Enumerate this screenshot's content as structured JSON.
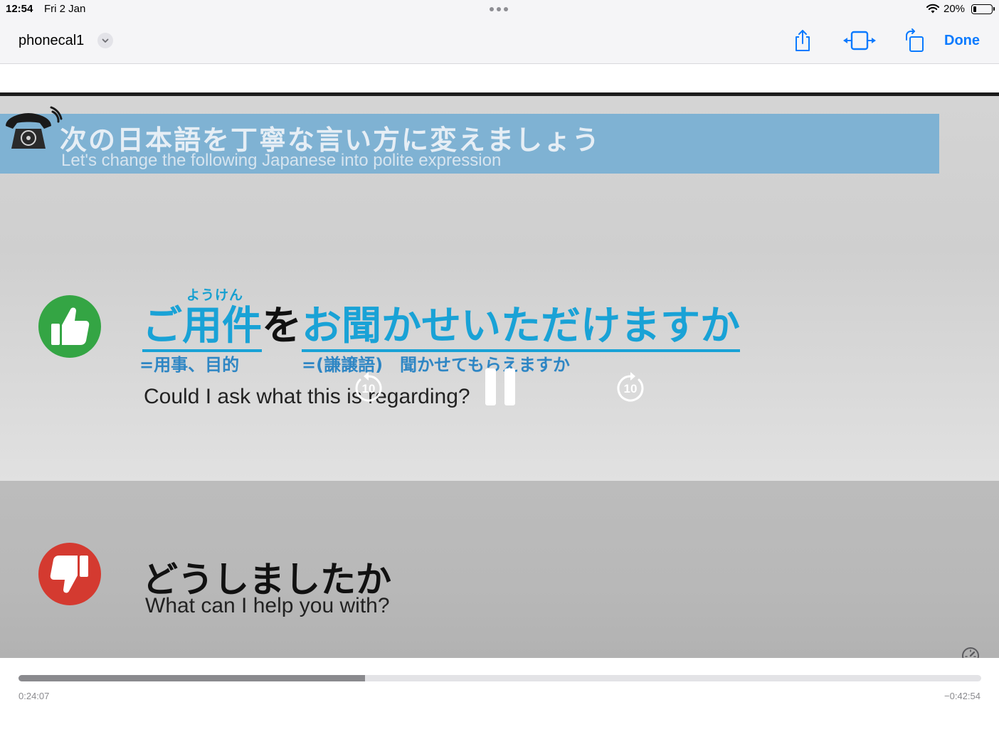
{
  "status_bar": {
    "time": "12:54",
    "date": "Fri 2 Jan",
    "battery_text": "20%",
    "battery_level": 0.2
  },
  "nav": {
    "title": "phonecal1",
    "done_label": "Done",
    "accent_color": "#0a7aff",
    "icons": [
      "chevron-down-icon",
      "share-icon",
      "fit-to-screen-icon",
      "rotate-icon"
    ]
  },
  "slide": {
    "banner_jp": "次の日本語を丁寧な言い方に変えましょう",
    "banner_en": "Let's change the following Japanese into polite expression",
    "polite": {
      "furigana": "ようけん",
      "part1": "ご用件",
      "particle": "を",
      "part2": "お聞かせいただけますか",
      "gloss_left": "=用事、目的",
      "gloss_right": "=(謙譲語)　聞かせてもらえますか",
      "english": "Could I ask what this is regarding?"
    },
    "casual": {
      "japanese": "どうしましたか",
      "english": "What can I help you with?"
    },
    "colors": {
      "banner": "#7fb2d3",
      "highlight": "#19a2d6",
      "good": "#34a544",
      "bad": "#d43a30"
    }
  },
  "playback": {
    "skip_back_seconds": "10",
    "skip_forward_seconds": "10",
    "elapsed": "0:24:07",
    "remaining": "−0:42:54",
    "progress": 0.3596
  }
}
